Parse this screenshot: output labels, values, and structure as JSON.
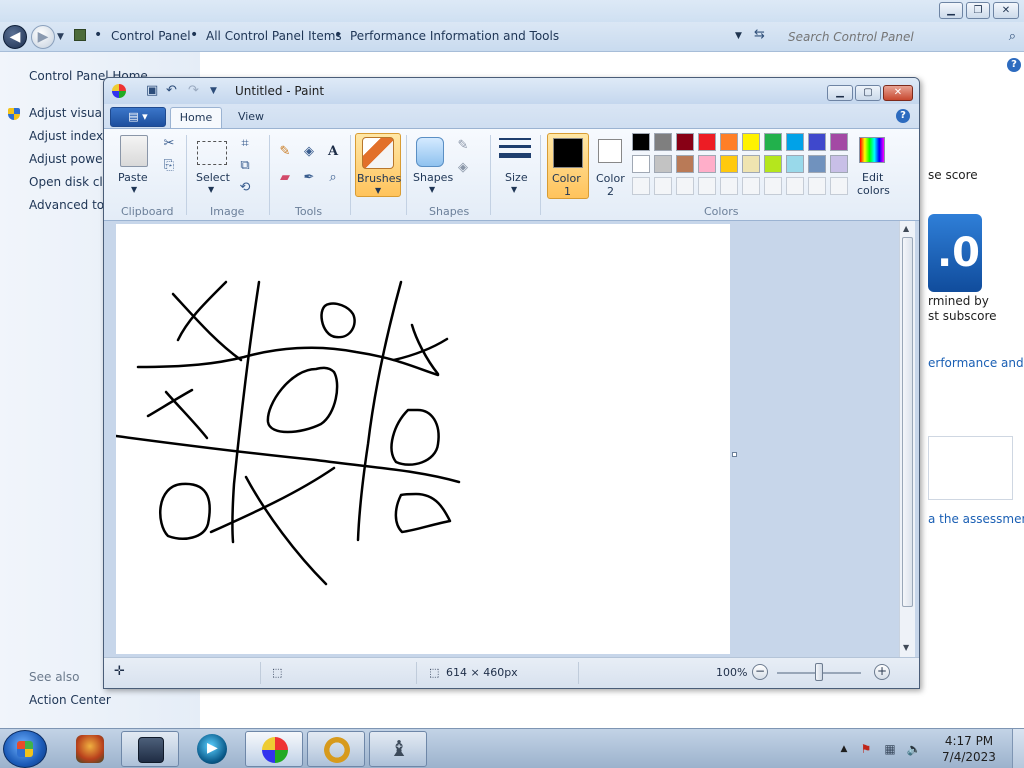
{
  "control_panel": {
    "breadcrumbs": [
      "Control Panel",
      "All Control Panel Items",
      "Performance Information and Tools"
    ],
    "search_placeholder": "Search Control Panel",
    "home_link": "Control Panel Home",
    "left_links": [
      "Adjust visual e",
      "Adjust indexin",
      "Adjust power",
      "Open disk clea",
      "Advanced too"
    ],
    "see_also": "See also",
    "action_center": "Action Center",
    "right_fragments": {
      "score_label": "se score",
      "score_value": ".0",
      "determined_by": "rmined by",
      "subscore": "st subscore",
      "performance_link": "erformance and",
      "assessment_link": "a the assessment"
    },
    "window_buttons": [
      "▁",
      "❐",
      "✕"
    ]
  },
  "paint": {
    "title": "Untitled - Paint",
    "file_menu": "▤ ▾",
    "tabs": [
      "Home",
      "View"
    ],
    "ribbon": {
      "clipboard": {
        "label": "Clipboard",
        "paste": "Paste"
      },
      "image": {
        "label": "Image",
        "select": "Select"
      },
      "tools": {
        "label": "Tools"
      },
      "brushes": "Brushes",
      "shapes": {
        "label": "Shapes",
        "button": "Shapes"
      },
      "size": "Size",
      "color1": "Color\n1",
      "color1_line1": "Color",
      "color1_line2": "1",
      "color2_line1": "Color",
      "color2_line2": "2",
      "colors": {
        "label": "Colors"
      },
      "edit_colors_line1": "Edit",
      "edit_colors_line2": "colors",
      "color1_value": "#000000",
      "color2_value": "#ffffff",
      "palette_row1": [
        "#000000",
        "#7f7f7f",
        "#880015",
        "#ed1c24",
        "#ff7f27",
        "#fff200",
        "#22b14c",
        "#00a2e8",
        "#3f48cc",
        "#a349a4"
      ],
      "palette_row2": [
        "#ffffff",
        "#c3c3c3",
        "#b97a57",
        "#ffaec9",
        "#ffc90e",
        "#efe4b0",
        "#b5e61d",
        "#99d9ea",
        "#7092be",
        "#c8bfe7"
      ]
    },
    "status": {
      "canvas_size": "614 × 460px",
      "zoom": "100%"
    }
  },
  "taskbar": {
    "time": "4:17 PM",
    "date": "7/4/2023"
  }
}
